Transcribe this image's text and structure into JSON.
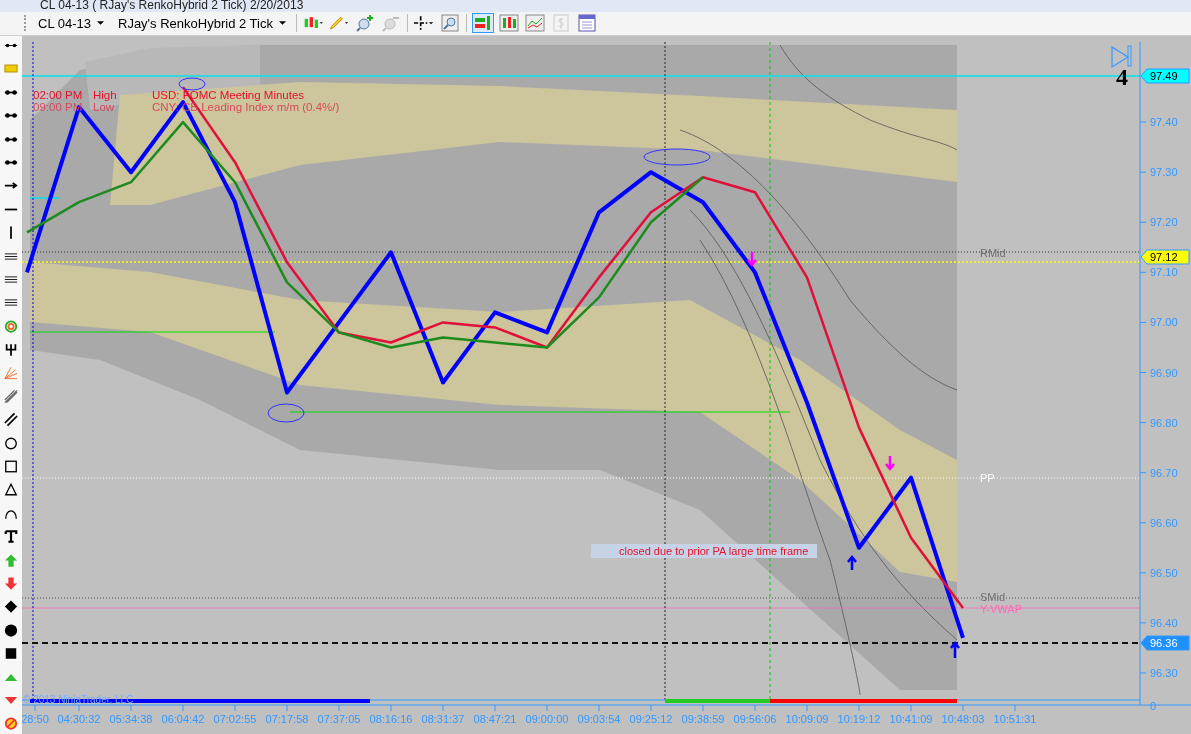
{
  "window": {
    "title": "CL 04-13 ( RJay's RenkoHybrid  2 Tick)  2/20/2013"
  },
  "toolbar": {
    "instrument": "CL 04-13",
    "chart_type": "RJay's RenkoHybrid  2 Tick"
  },
  "chart": {
    "events": [
      {
        "time": "02:00 PM",
        "type": "High",
        "text": "USD: FOMC Meeting Minutes",
        "kind": "high"
      },
      {
        "time": "09:00 PM",
        "type": "Low",
        "text": "CNY: CB Leading Index m/m (0.4%/)",
        "kind": "low"
      }
    ],
    "bar_counter": "4",
    "levels": [
      {
        "label": "RMid",
        "color": "#707070"
      },
      {
        "label": "PP",
        "color": "#ffffff"
      },
      {
        "label": "SMid",
        "color": "#707070"
      },
      {
        "label": "Y-VWAP",
        "color": "#ff69b4"
      }
    ],
    "note": "closed due to prior PA large time frame",
    "price_markers": [
      {
        "label": "97.49",
        "color": "#00ffff"
      },
      {
        "label": "97.12",
        "color": "#ffff00"
      },
      {
        "label": "96.36",
        "color": "#1e90ff"
      }
    ],
    "volume_axis_label": "0",
    "copyright": "© 2013 NinjaTrader, LLC",
    "chart_data": {
      "type": "line",
      "categories": [
        "28:50",
        "04:30:32",
        "05:34:38",
        "06:04:42",
        "07:02:55",
        "07:17:58",
        "07:37:05",
        "08:16:16",
        "08:31:37",
        "08:47:21",
        "09:00:00",
        "09:03:54",
        "09:25:12",
        "09:38:59",
        "09:56:06",
        "10:09:09",
        "10:19:12",
        "10:41:09",
        "10:48:03",
        "10:51:31"
      ],
      "series": [
        {
          "color": "#0000ff",
          "values": [
            97.1,
            97.43,
            97.3,
            97.44,
            97.24,
            96.86,
            97.0,
            97.14,
            96.88,
            97.02,
            96.98,
            97.22,
            97.3,
            97.24,
            97.1,
            96.84,
            96.55,
            96.69,
            96.37,
            null
          ]
        },
        {
          "color": "#e0103a",
          "values": [
            null,
            null,
            null,
            97.47,
            97.32,
            97.12,
            96.98,
            96.96,
            97.0,
            96.99,
            96.95,
            97.09,
            97.22,
            97.29,
            97.26,
            97.09,
            96.79,
            96.57,
            96.43,
            null
          ]
        },
        {
          "color": "#1e8b1e",
          "values": [
            97.18,
            97.24,
            97.28,
            97.4,
            97.28,
            97.08,
            96.98,
            96.95,
            96.97,
            96.96,
            96.95,
            97.05,
            97.2,
            97.29,
            null,
            null,
            null,
            null,
            null,
            null
          ]
        }
      ],
      "ylim": [
        96.25,
        97.56
      ],
      "yticks": [
        {
          "value": 96.3,
          "label": "96.30"
        },
        {
          "value": 96.4,
          "label": "96.40"
        },
        {
          "value": 96.5,
          "label": "96.50"
        },
        {
          "value": 96.6,
          "label": "96.60"
        },
        {
          "value": 96.7,
          "label": "96.70"
        },
        {
          "value": 96.8,
          "label": "96.80"
        },
        {
          "value": 96.9,
          "label": "96.90"
        },
        {
          "value": 97.0,
          "label": "97.00"
        },
        {
          "value": 97.1,
          "label": "97.10"
        },
        {
          "value": 97.2,
          "label": "97.20"
        },
        {
          "value": 97.3,
          "label": "97.30"
        },
        {
          "value": 97.4,
          "label": "97.40"
        }
      ]
    }
  }
}
